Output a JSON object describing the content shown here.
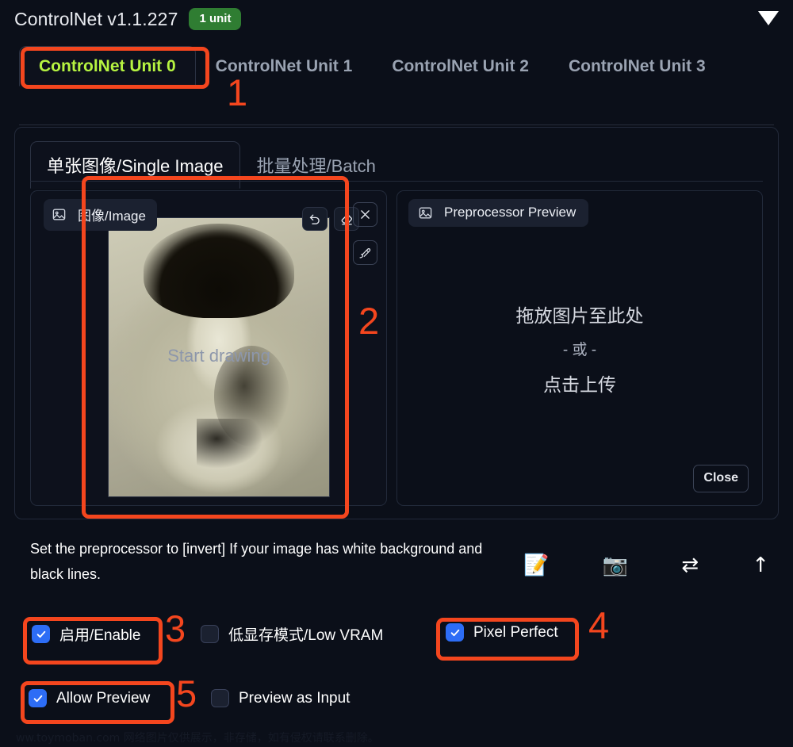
{
  "header": {
    "title": "ControlNet v1.1.227",
    "unit_badge": "1 unit",
    "collapse_icon": "triangle-down-icon",
    "badge_color": "#2f7d32",
    "active_tab_color": "#b6f441"
  },
  "unit_tabs": [
    {
      "label": "ControlNet Unit 0",
      "active": true
    },
    {
      "label": "ControlNet Unit 1",
      "active": false
    },
    {
      "label": "ControlNet Unit 2",
      "active": false
    },
    {
      "label": "ControlNet Unit 3",
      "active": false
    }
  ],
  "mode_tabs": [
    {
      "label": "单张图像/Single Image",
      "active": true
    },
    {
      "label": "批量处理/Batch",
      "active": false
    }
  ],
  "image_panel": {
    "label": "图像/Image",
    "label_icon": "image-icon",
    "canvas_overlay_text": "Start drawing",
    "tools": [
      {
        "name": "undo-icon",
        "title": "Undo"
      },
      {
        "name": "eraser-icon",
        "title": "Erase"
      },
      {
        "name": "remove-icon",
        "title": "Remove image"
      },
      {
        "name": "brush-icon",
        "title": "Draw"
      }
    ]
  },
  "preview_panel": {
    "label": "Preprocessor Preview",
    "label_icon": "image-icon",
    "drop_line1": "拖放图片至此处",
    "drop_line2": "- 或 -",
    "drop_line3": "点击上传",
    "close_label": "Close"
  },
  "hint": {
    "text": "Set the preprocessor to [invert] If your image has white background and black lines."
  },
  "emoji_tools": [
    {
      "name": "memo-icon",
      "glyph": "📝"
    },
    {
      "name": "camera-icon",
      "glyph": "📷"
    },
    {
      "name": "swap-arrows-icon",
      "glyph": "⇄"
    },
    {
      "name": "arrow-up-icon",
      "glyph": "↑"
    }
  ],
  "checkboxes": {
    "enable": {
      "label": "启用/Enable",
      "checked": true
    },
    "low_vram": {
      "label": "低显存模式/Low VRAM",
      "checked": false
    },
    "pixel_perfect": {
      "label": "Pixel Perfect",
      "checked": true
    },
    "allow_preview": {
      "label": "Allow Preview",
      "checked": true
    },
    "preview_input": {
      "label": "Preview as Input",
      "checked": false
    }
  },
  "annotations": {
    "color": "#f4461e",
    "markers": [
      {
        "n": "1",
        "target": "controlnet-unit-0-tab"
      },
      {
        "n": "2",
        "target": "image-upload-area"
      },
      {
        "n": "3",
        "target": "enable-checkbox"
      },
      {
        "n": "4",
        "target": "pixel-perfect-checkbox"
      },
      {
        "n": "5",
        "target": "allow-preview-checkbox"
      }
    ]
  },
  "watermark": {
    "text": "ww.toymoban.com 网络图片仅供展示，非存储，如有侵权请联系删除。"
  }
}
